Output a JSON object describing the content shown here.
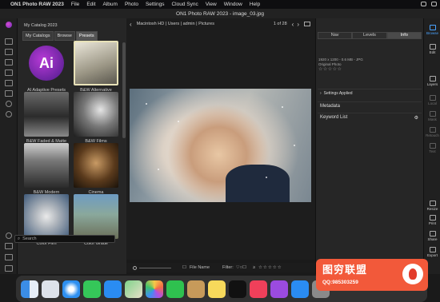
{
  "menubar": {
    "app": "ON1 Photo RAW 2023",
    "items": [
      "File",
      "Edit",
      "Album",
      "Photo",
      "Settings",
      "Cloud Sync",
      "View",
      "Window",
      "Help"
    ]
  },
  "window_title": "ON1 Photo RAW 2023 - image_03.jpg",
  "browser": {
    "catalog_label": "My Catalog 2023",
    "tabs": [
      "My Catalogs",
      "Browse",
      "Presets"
    ],
    "active_tab": "Presets",
    "presets": [
      {
        "label": "AI Adaptive Presets"
      },
      {
        "label": "B&W Alternative"
      },
      {
        "label": "B&W Faded & Matte"
      },
      {
        "label": "B&W Films"
      },
      {
        "label": "B&W Modern"
      },
      {
        "label": "Cinema"
      },
      {
        "label": "Color Film"
      },
      {
        "label": "Color Grade"
      }
    ],
    "search_placeholder": "Search"
  },
  "viewer": {
    "breadcrumb": [
      "Macintosh HD",
      "Users",
      "admin",
      "Pictures"
    ],
    "counter": "1 of 28"
  },
  "statusbar": {
    "sort_label": "File Name",
    "filter_label": "Filter:"
  },
  "right_panel": {
    "tabs": [
      "Nav",
      "Levels",
      "Info"
    ],
    "active_tab": "Info",
    "info_line1": "1920 x 1200 - 0.6 MB - JPG",
    "info_line2": "Original Photo",
    "stars": "☆☆☆☆☆",
    "settings_applied": "Settings Applied",
    "metadata": "Metadata",
    "keyword_list": "Keyword List"
  },
  "right_rail": {
    "items": [
      "Browse",
      "Edit",
      "Layers",
      "Local",
      "Mask",
      "Retouch",
      "Text",
      "Resize",
      "Print",
      "Share",
      "Export"
    ],
    "active": "Browse"
  },
  "dock": {
    "apps": [
      "Finder",
      "Launchpad",
      "Safari",
      "Messages",
      "Mail",
      "Maps",
      "Photos",
      "FaceTime",
      "Contacts",
      "Notes",
      "TV",
      "Music",
      "Podcasts",
      "App Store",
      "Settings"
    ]
  },
  "watermark": {
    "title": "图穷联盟",
    "qq": "QQ:985303259"
  },
  "colors": {
    "accent": "#4aa3ff",
    "panel": "#262626",
    "watermark": "#f2593a"
  }
}
